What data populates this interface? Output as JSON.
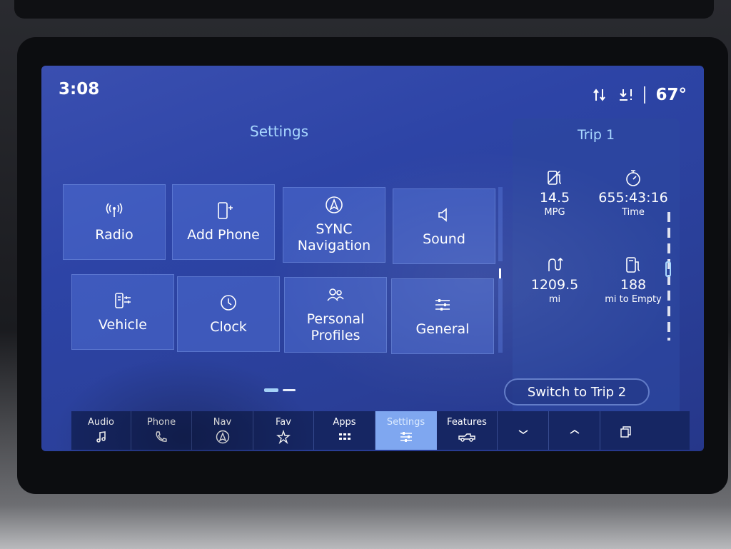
{
  "status": {
    "time": "3:08",
    "temperature": "67°"
  },
  "settings": {
    "title": "Settings",
    "tiles": [
      {
        "label": "Radio",
        "icon": "radio-icon"
      },
      {
        "label": "Add Phone",
        "icon": "add-phone-icon"
      },
      {
        "label": "SYNC Navigation",
        "icon": "navigation-icon"
      },
      {
        "label": "Sound",
        "icon": "speaker-icon"
      },
      {
        "label": "Vehicle",
        "icon": "vehicle-settings-icon"
      },
      {
        "label": "Clock",
        "icon": "clock-icon"
      },
      {
        "label": "Personal Profiles",
        "icon": "profiles-icon"
      },
      {
        "label": "General",
        "icon": "sliders-icon"
      }
    ],
    "page_count": 2,
    "current_page": 1
  },
  "trip": {
    "title": "Trip 1",
    "stats": [
      {
        "value": "14.5",
        "label": "MPG",
        "icon": "fuel-economy-icon"
      },
      {
        "value": "655:43:16",
        "label": "Time",
        "icon": "stopwatch-icon"
      },
      {
        "value": "1209.5",
        "label": "mi",
        "icon": "distance-icon"
      },
      {
        "value": "188",
        "label": "mi to Empty",
        "icon": "fuel-pump-icon"
      }
    ],
    "switch_label": "Switch to Trip 2"
  },
  "navbar": {
    "items": [
      {
        "label": "Audio",
        "icon": "music-note-icon"
      },
      {
        "label": "Phone",
        "icon": "phone-icon"
      },
      {
        "label": "Nav",
        "icon": "navigation-icon"
      },
      {
        "label": "Fav",
        "icon": "star-icon"
      },
      {
        "label": "Apps",
        "icon": "apps-grid-icon"
      },
      {
        "label": "Settings",
        "icon": "sliders-icon",
        "active": true
      },
      {
        "label": "Features",
        "icon": "truck-icon"
      },
      {
        "label": "",
        "icon": "chevron-down-icon"
      },
      {
        "label": "",
        "icon": "chevron-up-icon"
      },
      {
        "label": "",
        "icon": "windows-icon"
      }
    ]
  },
  "colors": {
    "accent": "#a9d8ff",
    "screen_bg": "#2d44a6",
    "active_tab": "#7fa7f0"
  }
}
